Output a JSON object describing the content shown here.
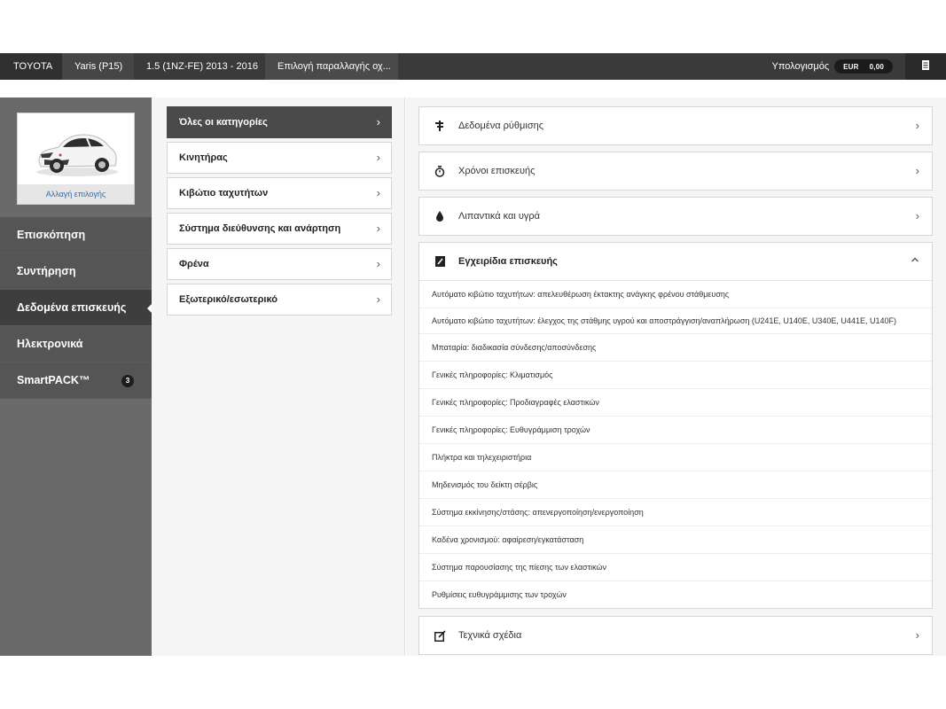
{
  "breadcrumb": {
    "items": [
      "TOYOTA",
      "Yaris (P15)",
      "1.5 (1NZ-FE) 2013 - 2016",
      "Επιλογή παραλλαγής οχ..."
    ],
    "calculator_label": "Υπολογισμός",
    "currency": "EUR",
    "amount": "0,00"
  },
  "vehicle": {
    "change_label": "Αλλαγή επιλογής"
  },
  "sidebar": {
    "items": [
      {
        "label": "Επισκόπηση"
      },
      {
        "label": "Συντήρηση"
      },
      {
        "label": "Δεδομένα επισκευής"
      },
      {
        "label": "Ηλεκτρονικά"
      },
      {
        "label": "SmartPACK™",
        "badge": "3"
      }
    ]
  },
  "categories": {
    "items": [
      {
        "label": "Όλες οι κατηγορίες"
      },
      {
        "label": "Κινητήρας"
      },
      {
        "label": "Κιβώτιο ταχυτήτων"
      },
      {
        "label": "Σύστημα διεύθυνσης και ανάρτηση"
      },
      {
        "label": "Φρένα"
      },
      {
        "label": "Εξωτερικό/εσωτερικό"
      }
    ]
  },
  "panels": {
    "adjustment": {
      "label": "Δεδομένα ρύθμισης",
      "icon": "wrench-icon"
    },
    "repair_times": {
      "label": "Χρόνοι επισκευής",
      "icon": "stopwatch-icon"
    },
    "fluids": {
      "label": "Λιπαντικά και υγρά",
      "icon": "drop-icon"
    },
    "manuals": {
      "label": "Εγχειρίδια επισκευής",
      "icon": "manual-icon",
      "items": [
        "Αυτόματο κιβώτιο ταχυτήτων: απελευθέρωση έκτακτης ανάγκης φρένου στάθμευσης",
        "Αυτόματο κιβώτιο ταχυτήτων: έλεγχος της στάθμης υγρού και αποστράγγιση/αναπλήρωση (U241E, U140E, U340E, U441E, U140F)",
        "Μπαταρία: διαδικασία σύνδεσης/αποσύνδεσης",
        "Γενικές πληροφορίες: Κλιματισμός",
        "Γενικές πληροφορίες: Προδιαγραφές ελαστικών",
        "Γενικές πληροφορίες: Ευθυγράμμιση τροχών",
        "Πλήκτρα και τηλεχειριστήρια",
        "Μηδενισμός του δείκτη σέρβις",
        "Σύστημα εκκίνησης/στάσης: απενεργοποίηση/ενεργοποίηση",
        "Καδένα χρονισμού: αφαίρεση/εγκατάσταση",
        "Σύστημα παρουσίασης της πίεσης των ελαστικών",
        "Ρυθμίσεις ευθυγράμμισης των τροχών"
      ]
    },
    "drawings": {
      "label": "Τεχνικά σχέδια",
      "icon": "edit-icon"
    }
  }
}
